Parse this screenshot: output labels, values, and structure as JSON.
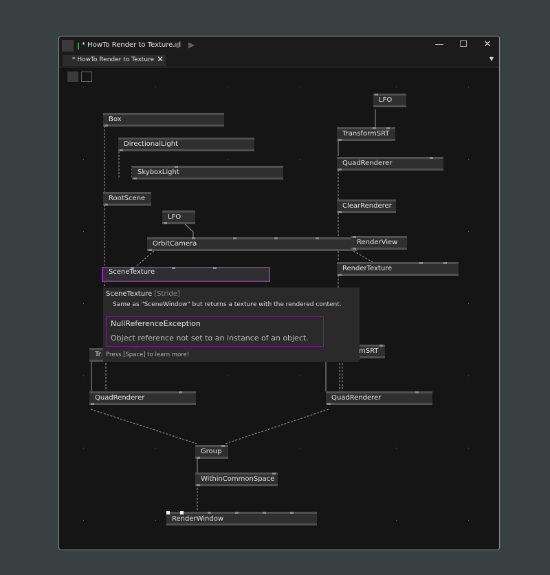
{
  "window": {
    "title": "* HowTo Render to Texture.vl",
    "nav_back": "◀",
    "nav_forward": "▶",
    "minimize": "—",
    "maximize": "☐",
    "close": "✕"
  },
  "tab": {
    "label": "* HowTo Render to Texture",
    "close": "✕",
    "menu": "▼"
  },
  "nodes": {
    "lfo_top": "LFO",
    "transform_srt_top": "TransformSRT",
    "quad_renderer_top": "QuadRenderer",
    "box": "Box",
    "directional_light": "DirectionalLight",
    "skybox_light": "SkyboxLight",
    "root_scene": "RootScene",
    "clear_renderer": "ClearRenderer",
    "lfo_mid": "LFO",
    "orbit_camera": "OrbitCamera",
    "render_view": "RenderView",
    "scene_texture": "SceneTexture",
    "render_texture": "RenderTexture",
    "tr_partial": "Tr",
    "msrt_partial": "mSRT",
    "quad_renderer_left": "QuadRenderer",
    "quad_renderer_right": "QuadRenderer",
    "group": "Group",
    "within_common_space": "WithinCommonSpace",
    "render_window": "RenderWindow"
  },
  "tooltip": {
    "title": "SceneTexture",
    "category": "[Stride]",
    "description": "Same as \"SceneWindow\" but returns a texture with the rendered content.",
    "error_title": "NullReferenceException",
    "error_message": "Object reference not set to an instance of an object.",
    "hint": "Press [Space] to learn more!"
  },
  "colors": {
    "background": "#394140",
    "canvas": "#151515",
    "node": "#2f2f2f",
    "selection": "#a020c8",
    "tooltip": "#2a2a2a",
    "active_indicator": "#3fa34d"
  }
}
